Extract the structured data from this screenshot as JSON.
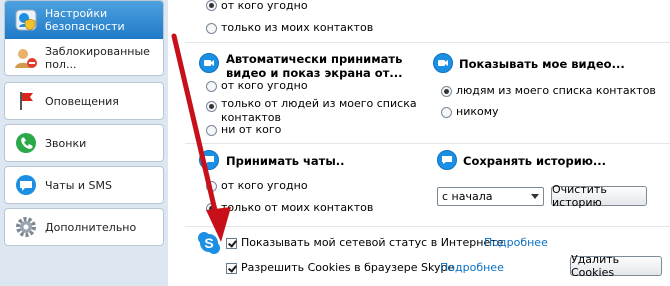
{
  "sidebar": {
    "items": [
      {
        "label": "Настройки безопасности",
        "icon": "security-settings-icon",
        "selected": true
      },
      {
        "label": "Заблокированные пол...",
        "icon": "blocked-users-icon"
      },
      {
        "label": "Оповещения",
        "icon": "flag-icon"
      },
      {
        "label": "Звонки",
        "icon": "phone-icon"
      },
      {
        "label": "Чаты и SMS",
        "icon": "chat-icon"
      },
      {
        "label": "Дополнительно",
        "icon": "gear-icon"
      }
    ]
  },
  "calls_section": {
    "options": [
      "от кого угодно",
      "только из моих контактов"
    ],
    "selected": 0
  },
  "auto_video": {
    "title": "Автоматически принимать видео и показ экрана от...",
    "options": [
      "от кого угодно",
      "только от людей из моего списка контактов",
      "ни от кого"
    ],
    "selected": 1
  },
  "show_video": {
    "title": "Показывать мое видео...",
    "options": [
      "людям из моего списка контактов",
      "никому"
    ],
    "selected": 0
  },
  "accept_chats": {
    "title": "Принимать чаты..",
    "options": [
      "от кого угодно",
      "только от моих контактов"
    ],
    "selected": 1
  },
  "save_history": {
    "title": "Сохранять историю...",
    "select_value": "с начала",
    "clear_button": "Очистить историю"
  },
  "footer": {
    "online_status_label": "Показывать мой сетевой статус в Интернете",
    "online_status_checked": true,
    "online_status_link": "Подробнее",
    "cookies_label": "Разрешить Cookies в браузере Skype",
    "cookies_checked": true,
    "cookies_link": "Подробнее",
    "delete_cookies_button": "Удалить Cookies"
  },
  "colors": {
    "accent": "#1f7ac7",
    "link": "#0a6fc2",
    "arrow": "#c8101a",
    "sidebar_bg": "#dde7f1"
  }
}
